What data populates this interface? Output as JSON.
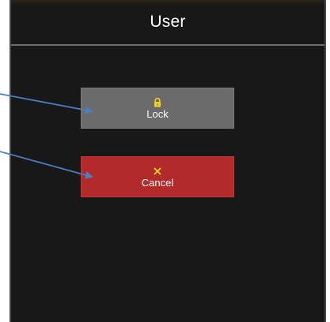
{
  "dialog": {
    "title": "User"
  },
  "buttons": {
    "lock": {
      "label": "Lock",
      "icon": "lock-icon",
      "color": "#6b6b6b",
      "icon_color": "#f2d21b"
    },
    "cancel": {
      "label": "Cancel",
      "icon": "close-icon",
      "color": "#b22a2a",
      "icon_color": "#f2d21b"
    }
  },
  "annotation": {
    "arrow_color": "#4a7fc1"
  }
}
